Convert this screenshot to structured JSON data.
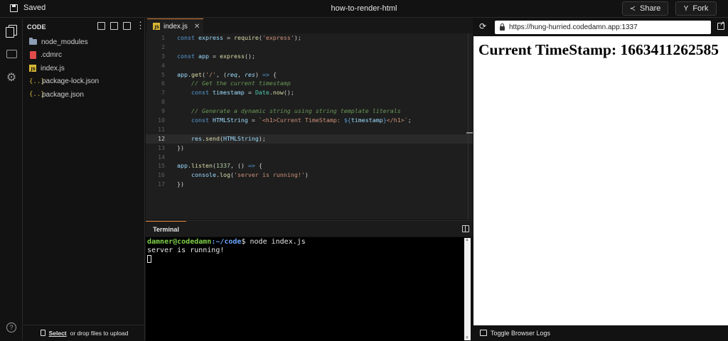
{
  "topbar": {
    "saved_label": "Saved",
    "title": "how-to-render-html",
    "share_label": "Share",
    "fork_label": "Fork"
  },
  "explorer": {
    "header": "CODE",
    "files": [
      {
        "name": "node_modules",
        "icon": "folder-icon"
      },
      {
        "name": ".cdmrc",
        "icon": "file-icon"
      },
      {
        "name": "index.js",
        "icon": "js-file-icon"
      },
      {
        "name": "package-lock.json",
        "icon": "json-file-icon"
      },
      {
        "name": "package.json",
        "icon": "json-file-icon"
      }
    ],
    "upload_link": "Select",
    "upload_text": "or drop files to upload"
  },
  "editor": {
    "tab_label": "index.js",
    "active_line": 12,
    "line_count": 17
  },
  "terminal": {
    "tab_label": "Terminal",
    "prompt_user": "damner@codedamn",
    "prompt_path": ":~/code",
    "prompt_command": "$ node index.js",
    "output": "server is running!"
  },
  "preview": {
    "url": "https://hung-hurried.codedamn.app:1337",
    "heading": "Current TimeStamp: 1663411262585",
    "logs_label": "Toggle Browser Logs"
  },
  "colors": {
    "accent": "#e0833c",
    "background": "#121212",
    "editor_bg": "#1e1e1e",
    "prompt_user": "#7fd14a",
    "prompt_path": "#6aa6ff"
  }
}
